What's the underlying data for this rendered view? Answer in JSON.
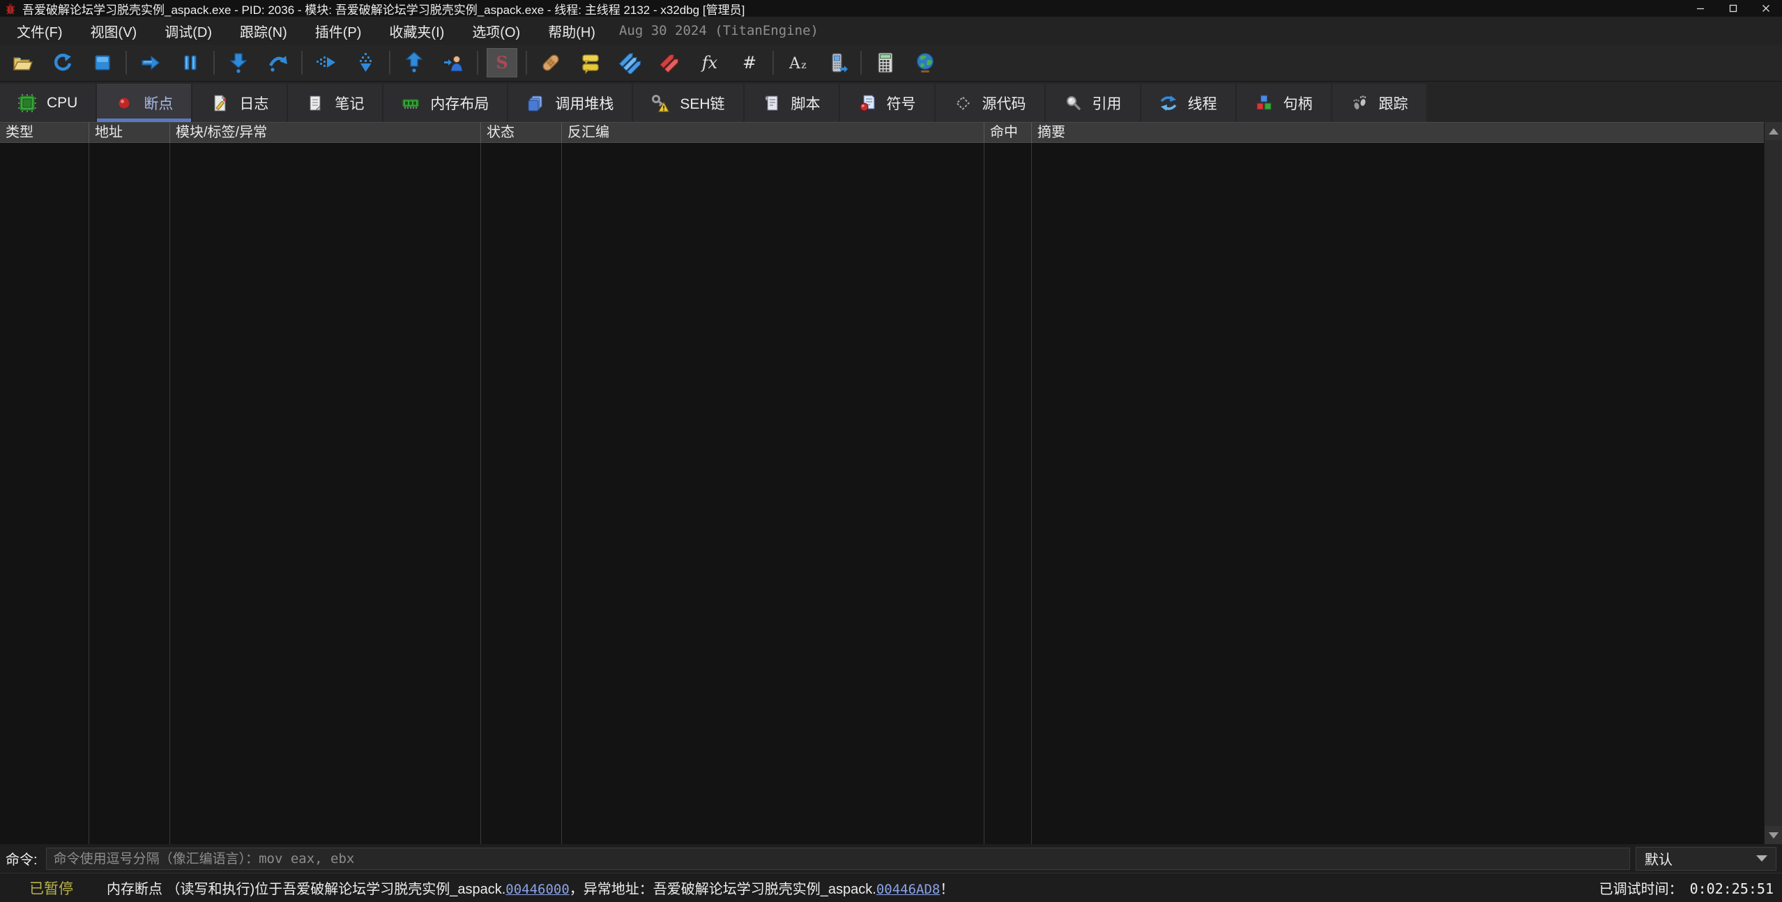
{
  "window": {
    "title": "吾爱破解论坛学习脱壳实例_aspack.exe - PID: 2036 - 模块: 吾爱破解论坛学习脱壳实例_aspack.exe - 线程: 主线程 2132 - x32dbg [管理员]",
    "app_icon": "bug-icon",
    "controls": [
      "minimize",
      "maximize",
      "close"
    ]
  },
  "menu": {
    "items": [
      "文件(F)",
      "视图(V)",
      "调试(D)",
      "跟踪(N)",
      "插件(P)",
      "收藏夹(I)",
      "选项(O)",
      "帮助(H)"
    ],
    "build_info": "Aug 30 2024 (TitanEngine)"
  },
  "toolbar": {
    "buttons": [
      {
        "icon": "open-folder-icon"
      },
      {
        "icon": "restart-icon"
      },
      {
        "icon": "stop-icon"
      },
      {
        "icon": "run-icon"
      },
      {
        "icon": "pause-icon"
      },
      {
        "icon": "step-into-icon"
      },
      {
        "icon": "step-over-icon"
      },
      {
        "icon": "trace-over-icon"
      },
      {
        "icon": "trace-into-icon"
      },
      {
        "icon": "execute-till-return-icon"
      },
      {
        "icon": "run-to-user-code-icon"
      },
      {
        "icon": "scylla-icon",
        "pressed": true
      },
      {
        "icon": "patches-icon"
      },
      {
        "icon": "comments-icon"
      },
      {
        "icon": "labels-icon"
      },
      {
        "icon": "breakpoints-icon"
      },
      {
        "icon": "functions-icon"
      },
      {
        "icon": "hash-icon"
      },
      {
        "icon": "strings-icon"
      },
      {
        "icon": "phone-icon"
      },
      {
        "icon": "calculator-icon"
      },
      {
        "icon": "globe-icon"
      }
    ]
  },
  "tabs": [
    {
      "label": "CPU",
      "icon": "cpu-icon",
      "active": false
    },
    {
      "label": "断点",
      "icon": "breakpoint-dot-icon",
      "active": true
    },
    {
      "label": "日志",
      "icon": "log-icon",
      "active": false
    },
    {
      "label": "笔记",
      "icon": "notes-icon",
      "active": false
    },
    {
      "label": "内存布局",
      "icon": "memory-map-icon",
      "active": false
    },
    {
      "label": "调用堆栈",
      "icon": "call-stack-icon",
      "active": false
    },
    {
      "label": "SEH链",
      "icon": "seh-chain-icon",
      "active": false
    },
    {
      "label": "脚本",
      "icon": "script-icon",
      "active": false
    },
    {
      "label": "符号",
      "icon": "symbols-icon",
      "active": false
    },
    {
      "label": "源代码",
      "icon": "source-icon",
      "active": false
    },
    {
      "label": "引用",
      "icon": "references-icon",
      "active": false
    },
    {
      "label": "线程",
      "icon": "threads-icon",
      "active": false
    },
    {
      "label": "句柄",
      "icon": "handles-icon",
      "active": false
    },
    {
      "label": "跟踪",
      "icon": "trace-icon",
      "active": false
    }
  ],
  "breakpoints_table": {
    "columns": [
      "类型",
      "地址",
      "模块/标签/异常",
      "状态",
      "反汇编",
      "命中",
      "摘要"
    ],
    "rows": []
  },
  "command_bar": {
    "label": "命令:",
    "value": "",
    "placeholder": "命令使用逗号分隔（像汇编语言）：mov eax, ebx",
    "profile": "默认"
  },
  "status_bar": {
    "state": "已暂停",
    "message_parts": [
      {
        "text": "内存断点 （读写和执行)位于吾爱破解论坛学习脱壳实例_aspack.",
        "link": false
      },
      {
        "text": "00446000",
        "link": true
      },
      {
        "text": "，异常地址：吾爱破解论坛学习脱壳实例_aspack.",
        "link": false
      },
      {
        "text": "00446AD8",
        "link": true
      },
      {
        "text": "！",
        "link": false
      }
    ],
    "debug_time_label": "已调试时间：",
    "debug_time": "0:02:25:51"
  },
  "colors": {
    "accent_tab_underline": "#5b79c2",
    "link_blue": "#8aa2e8",
    "paused_yellow": "#b9b24a",
    "icon_blue": "#3190e0",
    "table_bg": "#131313",
    "header_bg": "#3b3b3b"
  }
}
